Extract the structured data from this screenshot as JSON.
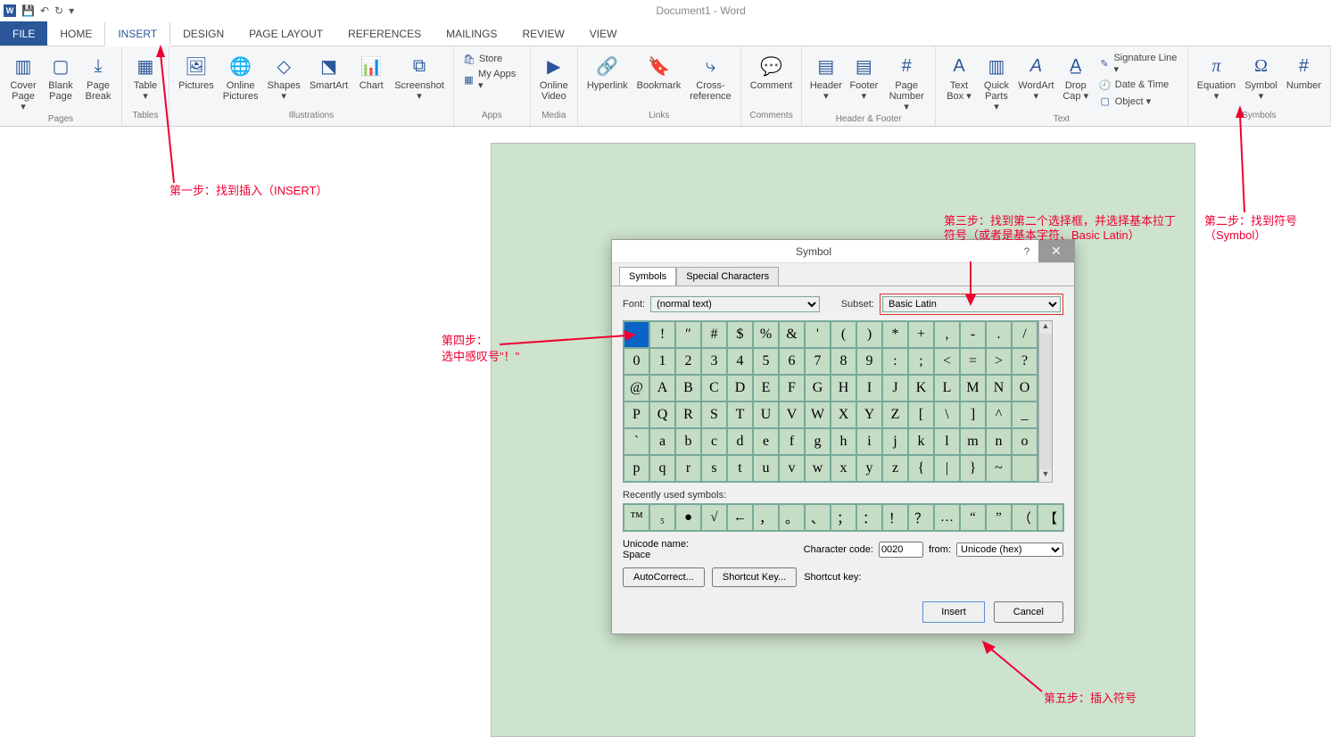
{
  "title": "Document1 - Word",
  "qat": {
    "word": "W"
  },
  "tabs": [
    "FILE",
    "HOME",
    "INSERT",
    "DESIGN",
    "PAGE LAYOUT",
    "REFERENCES",
    "MAILINGS",
    "REVIEW",
    "VIEW"
  ],
  "ribbon": {
    "pages": {
      "label": "Pages",
      "cover": "Cover\nPage ▾",
      "blank": "Blank\nPage",
      "break": "Page\nBreak"
    },
    "tables": {
      "label": "Tables",
      "table": "Table\n▾"
    },
    "illus": {
      "label": "Illustrations",
      "pictures": "Pictures",
      "online": "Online\nPictures",
      "shapes": "Shapes\n▾",
      "smartart": "SmartArt",
      "chart": "Chart",
      "screenshot": "Screenshot\n▾"
    },
    "apps": {
      "label": "Apps",
      "store": "Store",
      "myapps": "My Apps ▾"
    },
    "media": {
      "label": "Media",
      "video": "Online\nVideo"
    },
    "links": {
      "label": "Links",
      "hyper": "Hyperlink",
      "bookmark": "Bookmark",
      "cross": "Cross-\nreference"
    },
    "comments": {
      "label": "Comments",
      "comment": "Comment"
    },
    "hf": {
      "label": "Header & Footer",
      "header": "Header\n▾",
      "footer": "Footer\n▾",
      "pagenum": "Page\nNumber ▾"
    },
    "text": {
      "label": "Text",
      "textbox": "Text\nBox ▾",
      "quick": "Quick\nParts ▾",
      "wordart": "WordArt\n▾",
      "drop": "Drop\nCap ▾",
      "sig": "Signature Line ▾",
      "date": "Date & Time",
      "obj": "Object ▾"
    },
    "symbols": {
      "label": "Symbols",
      "eq": "Equation\n▾",
      "sym": "Symbol\n▾",
      "num": "Number"
    }
  },
  "dialog": {
    "title": "Symbol",
    "tab_symbols": "Symbols",
    "tab_special": "Special Characters",
    "font_label": "Font:",
    "font_value": "(normal text)",
    "subset_label": "Subset:",
    "subset_value": "Basic Latin",
    "grid": [
      [
        " ",
        "!",
        "″",
        "#",
        "$",
        "%",
        "&",
        "'",
        "(",
        ")",
        "*",
        "+",
        ",",
        "-",
        ".",
        "/"
      ],
      [
        "0",
        "1",
        "2",
        "3",
        "4",
        "5",
        "6",
        "7",
        "8",
        "9",
        ":",
        ";",
        "<",
        "=",
        ">",
        "?"
      ],
      [
        "@",
        "A",
        "B",
        "C",
        "D",
        "E",
        "F",
        "G",
        "H",
        "I",
        "J",
        "K",
        "L",
        "M",
        "N",
        "O"
      ],
      [
        "P",
        "Q",
        "R",
        "S",
        "T",
        "U",
        "V",
        "W",
        "X",
        "Y",
        "Z",
        "[",
        "\\",
        "]",
        "^",
        "_"
      ],
      [
        "`",
        "a",
        "b",
        "c",
        "d",
        "e",
        "f",
        "g",
        "h",
        "i",
        "j",
        "k",
        "l",
        "m",
        "n",
        "o"
      ],
      [
        "p",
        "q",
        "r",
        "s",
        "t",
        "u",
        "v",
        "w",
        "x",
        "y",
        "z",
        "{",
        "|",
        "}",
        "~",
        ""
      ]
    ],
    "recent_label": "Recently used symbols:",
    "recent": [
      "™",
      "₅",
      "●",
      "√",
      "←",
      "，",
      "。",
      "、",
      "；",
      "：",
      "！",
      "？",
      "…",
      "“",
      "”",
      "（",
      "【"
    ],
    "unicode_label": "Unicode name:",
    "unicode_value": "Space",
    "charcode_label": "Character code:",
    "charcode_value": "0020",
    "from_label": "from:",
    "from_value": "Unicode (hex)",
    "autocorrect": "AutoCorrect...",
    "shortcut_btn": "Shortcut Key...",
    "shortcut_label": "Shortcut key:",
    "insert": "Insert",
    "cancel": "Cancel"
  },
  "annot": {
    "step1": "第一步：找到插入（INSERT）",
    "step2": "第二步：找到符号（Symbol）",
    "step3": "第三步：找到第二个选择框，并选择基本拉丁符号（或者是基本字符、Basic Latin）",
    "step4a": "第四步：",
    "step4b": "选中感叹号\"！\"",
    "step5": "第五步：插入符号"
  }
}
